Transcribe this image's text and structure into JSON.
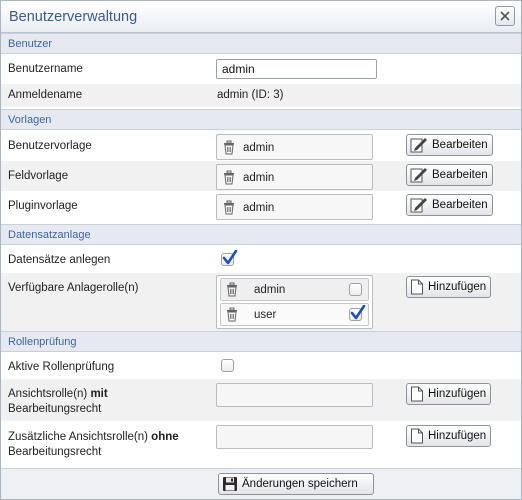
{
  "dialog": {
    "title": "Benutzerverwaltung"
  },
  "sections": {
    "benutzer": "Benutzer",
    "vorlagen": "Vorlagen",
    "datensatzanlage": "Datensatzanlage",
    "rollenpruefung": "Rollenprüfung"
  },
  "benutzer": {
    "username_label": "Benutzername",
    "username_value": "admin",
    "login_label": "Anmeldename",
    "login_value": "admin (ID: 3)"
  },
  "vorlagen": {
    "edit_label": "Bearbeiten",
    "items": [
      {
        "label": "Benutzervorlage",
        "value": "admin"
      },
      {
        "label": "Feldvorlage",
        "value": "admin"
      },
      {
        "label": "Pluginvorlage",
        "value": "admin"
      }
    ]
  },
  "datensatzanlage": {
    "create_label": "Datensätze anlegen",
    "create_checked": true,
    "roles_label": "Verfügbare Anlagerolle(n)",
    "add_label": "Hinzufügen",
    "roles": [
      {
        "name": "admin",
        "checked": false
      },
      {
        "name": "user",
        "checked": true
      }
    ]
  },
  "rollenpruefung": {
    "active_label": "Aktive Rollenprüfung",
    "active_checked": false,
    "view_with_prefix": "Ansichtsrolle(n) ",
    "view_with_bold": "mit",
    "view_with_suffix": "Bearbeitungsrecht",
    "extra_prefix": "Zusätzliche Ansichtsrolle(n) ",
    "extra_bold": "ohne",
    "extra_suffix": "Bearbeitungsrecht",
    "add_label": "Hinzufügen"
  },
  "footer": {
    "save_label": "Änderungen speichern"
  },
  "colors": {
    "section_text": "#3d63a0",
    "title_text": "#3d5a8a",
    "check_blue": "#1f4fb3"
  }
}
